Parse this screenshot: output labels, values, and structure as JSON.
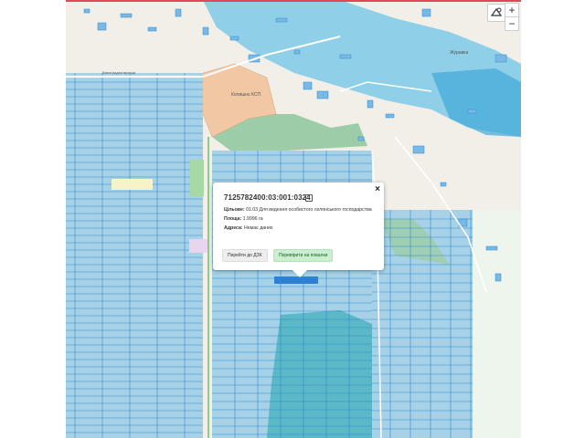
{
  "popup": {
    "cadastral_number": "7125782400:03:001:0324",
    "purpose_label": "Цільове:",
    "purpose_value": "01.03 Для ведення особистого селянського господарства",
    "area_label": "Площа:",
    "area_value": "1.9996 га",
    "address_label": "Адреса:",
    "address_value": "Немає даних",
    "btn_dzk": "Перейти до ДЗК",
    "btn_check": "Перевірити на повалки",
    "close": "×"
  },
  "controls": {
    "zoom_in": "+",
    "zoom_out": "−",
    "layers_icon": "layers-icon"
  },
  "labels": {
    "colony": "Колишнє КСП",
    "village": "Журавка",
    "street_vynogradna": "Виноградна вулиця"
  },
  "colors": {
    "parcel_fill": "#a7d1e6",
    "parcel_stroke": "#2a8bd1",
    "water": "#8fd0e8",
    "forest": "#c7e4cc",
    "ksp": "#f2c7a3",
    "selected_parcel": "#2d7fd4",
    "dark_parcel": "#5bb8c6"
  }
}
